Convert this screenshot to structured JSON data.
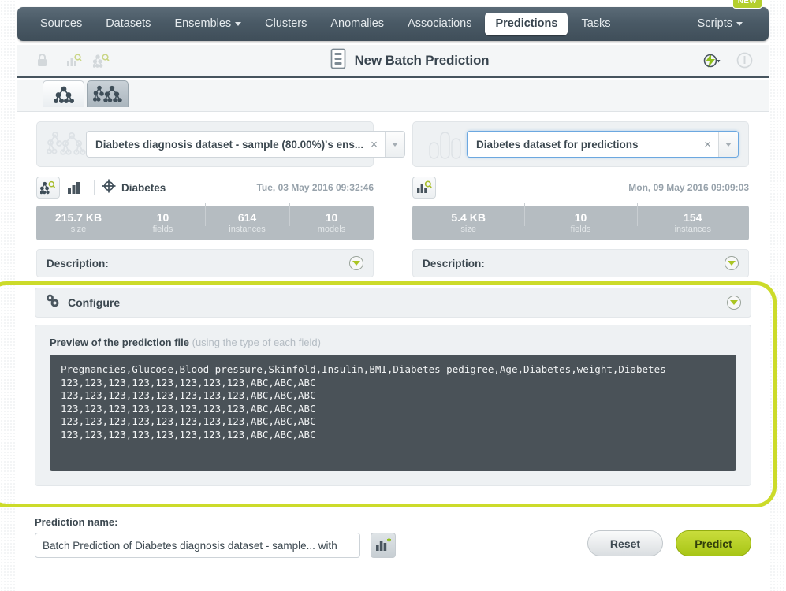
{
  "nav": {
    "items": [
      {
        "label": "Sources",
        "active": false,
        "caret": false
      },
      {
        "label": "Datasets",
        "active": false,
        "caret": false
      },
      {
        "label": "Ensembles",
        "active": false,
        "caret": true
      },
      {
        "label": "Clusters",
        "active": false,
        "caret": false
      },
      {
        "label": "Anomalies",
        "active": false,
        "caret": false
      },
      {
        "label": "Associations",
        "active": false,
        "caret": false
      },
      {
        "label": "Predictions",
        "active": true,
        "caret": false
      },
      {
        "label": "Tasks",
        "active": false,
        "caret": false
      }
    ],
    "scripts_label": "Scripts",
    "new_badge": "NEW"
  },
  "header": {
    "title": "New Batch Prediction",
    "lock_icon": "lock-icon",
    "dataset_search_icon": "dataset-search-icon",
    "model_search_icon": "model-search-icon",
    "batch_icon": "batch-prediction-icon",
    "lightning_icon": "lightning-icon",
    "info_icon": "info-icon"
  },
  "mode_tabs": [
    {
      "name": "single-model-tab",
      "icon": "single-tree-icon",
      "active": false
    },
    {
      "name": "ensemble-tab",
      "icon": "ensemble-trees-icon",
      "active": true
    }
  ],
  "left_panel": {
    "selector": {
      "icon": "ensemble-trees-icon",
      "value": "Diabetes diagnosis dataset - sample (80.00%)'s ens...",
      "clear": "×",
      "focused": false
    },
    "objective": "Diabetes",
    "date": "Tue, 03 May 2016 09:32:46",
    "stats": [
      {
        "value": "215.7 KB",
        "label": "size"
      },
      {
        "value": "10",
        "label": "fields"
      },
      {
        "value": "614",
        "label": "instances"
      },
      {
        "value": "10",
        "label": "models"
      }
    ],
    "description_label": "Description:"
  },
  "right_panel": {
    "selector": {
      "icon": "dataset-bars-icon",
      "value": "Diabetes dataset for predictions",
      "clear": "×",
      "focused": true
    },
    "date": "Mon, 09 May 2016 09:09:03",
    "stats": [
      {
        "value": "5.4 KB",
        "label": "size"
      },
      {
        "value": "10",
        "label": "fields"
      },
      {
        "value": "154",
        "label": "instances"
      }
    ],
    "description_label": "Description:"
  },
  "configure": {
    "title": "Configure",
    "icon": "gears-icon",
    "preview_title": "Preview of the prediction file",
    "preview_hint": "(using the type of each field)",
    "preview_lines": [
      "Pregnancies,Glucose,Blood pressure,Skinfold,Insulin,BMI,Diabetes pedigree,Age,Diabetes,weight,Diabetes",
      "123,123,123,123,123,123,123,123,ABC,ABC,ABC",
      "123,123,123,123,123,123,123,123,ABC,ABC,ABC",
      "123,123,123,123,123,123,123,123,ABC,ABC,ABC",
      "123,123,123,123,123,123,123,123,ABC,ABC,ABC",
      "123,123,123,123,123,123,123,123,ABC,ABC,ABC"
    ]
  },
  "bottom": {
    "prediction_name_label": "Prediction name:",
    "prediction_name_value": "Batch Prediction of Diabetes diagnosis dataset - sample... with",
    "prediction_name_placeholder": "Prediction name",
    "create_dataset_icon": "create-dataset-icon",
    "reset_label": "Reset",
    "predict_label": "Predict"
  },
  "colors": {
    "accent_green": "#aac523",
    "predict_green": "#a8c516",
    "annotation_yellow": "#ccdb2a",
    "navbar_dark": "#4a5a66",
    "code_bg": "#4a5258"
  }
}
